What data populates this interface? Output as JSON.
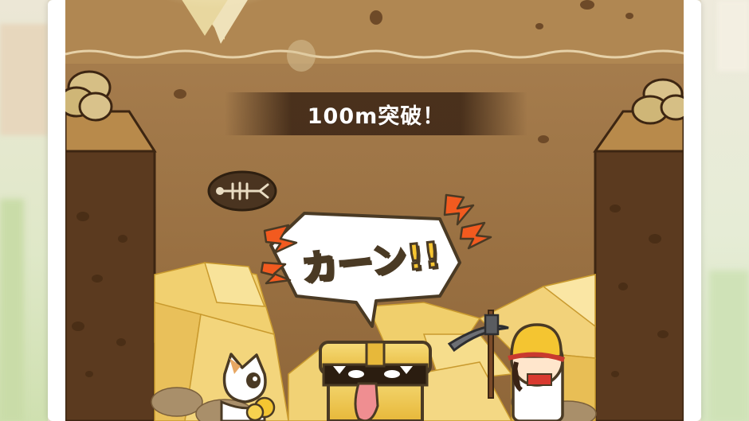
{
  "game": {
    "depth_banner": "100m突破！",
    "sfx_text": "カーン!!"
  },
  "colors": {
    "soil": "#a87c4d",
    "soil_deep": "#8a6035",
    "wall_dark": "#5b3a1f",
    "gold": "#f3cc53",
    "outline": "#4a3a24"
  },
  "icons": {
    "fossil": "fish-bone-icon",
    "miner": "miner-character",
    "cat": "cat-character",
    "chest": "treasure-chest-monster"
  }
}
